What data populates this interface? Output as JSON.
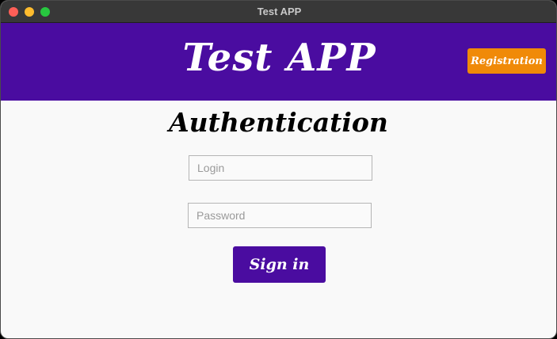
{
  "window": {
    "title": "Test APP"
  },
  "header": {
    "title": "Test APP",
    "registration_label": "Registration"
  },
  "auth": {
    "title": "Authentication",
    "login_placeholder": "Login",
    "password_placeholder": "Password",
    "signin_label": "Sign in"
  },
  "colors": {
    "header_bg": "#4a0ca0",
    "registration_bg": "#f08a08",
    "signin_bg": "#4a0ca0",
    "content_bg": "#f9f9f9"
  }
}
